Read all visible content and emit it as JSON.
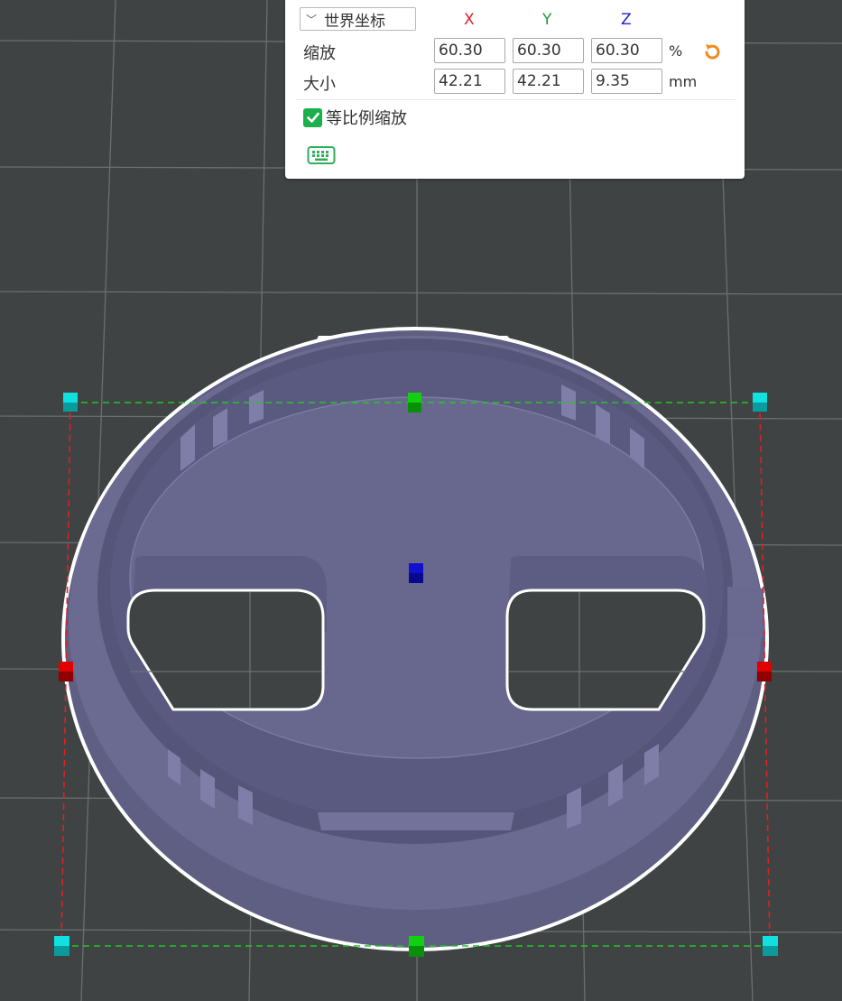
{
  "scale_panel": {
    "coordinate_system": {
      "selected": "世界坐标"
    },
    "axes": {
      "x": "X",
      "y": "Y",
      "z": "Z"
    },
    "axis_colors": {
      "x": "#e02020",
      "y": "#1e9b3a",
      "z": "#2020d0"
    },
    "scale_row": {
      "label": "缩放",
      "x": "60.30",
      "y": "60.30",
      "z": "60.30",
      "unit": "%"
    },
    "size_row": {
      "label": "大小",
      "x": "42.21",
      "y": "42.21",
      "z": "9.35",
      "unit": "mm"
    },
    "uniform_scale": {
      "label": "等比例缩放",
      "checked": true
    },
    "reset_icon": "reset-rotate-icon",
    "keyboard_icon": "keyboard-icon"
  },
  "theme": {
    "viewport_bg": "#3f4343",
    "grid_line": "#6a6e6e",
    "model_color": "#6e6e96",
    "bbox_red": "#e02020",
    "bbox_green": "#22c822",
    "handle_cyan": "#10e0e0",
    "handle_red": "#e00000",
    "handle_green": "#10d010",
    "handle_blue": "#1010d0",
    "accent_check": "#1bb04c",
    "accent_orange": "#f08a1c"
  }
}
